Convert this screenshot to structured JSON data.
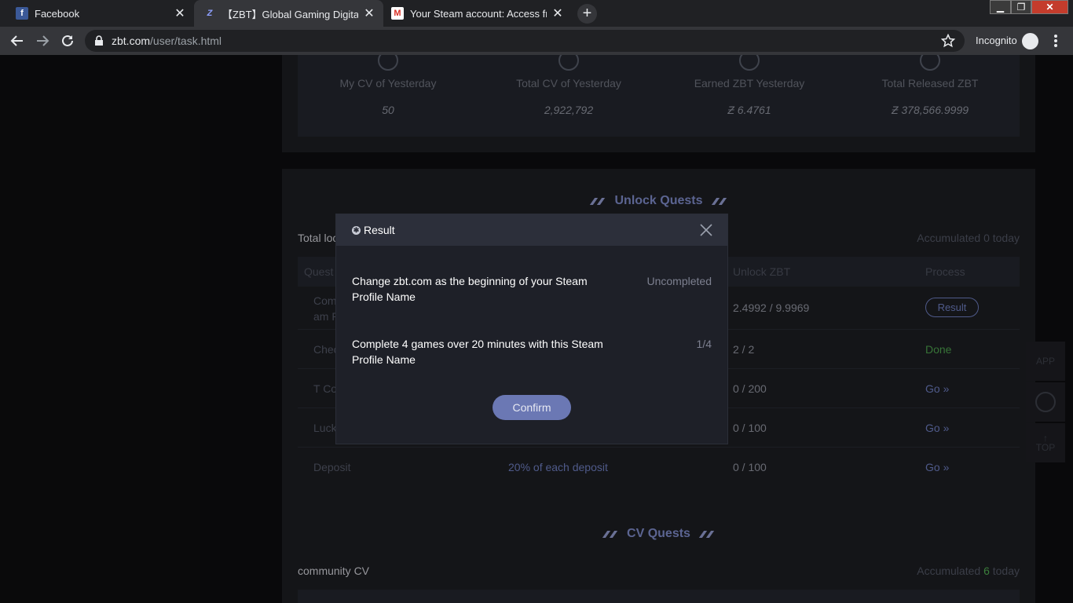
{
  "browser": {
    "tabs": [
      {
        "title": "Facebook",
        "favicon": "facebook-icon"
      },
      {
        "title": "【ZBT】Global Gaming Digital Asse",
        "favicon": "zbt-icon",
        "active": true
      },
      {
        "title": "Your Steam account: Access from",
        "favicon": "gmail-icon"
      }
    ],
    "url_host": "zbt.com",
    "url_path": "/user/task.html",
    "incognito_label": "Incognito"
  },
  "stats": [
    {
      "label": "My CV of Yesterday",
      "value": "50"
    },
    {
      "label": "Total CV of Yesterday",
      "value": "2,922,792"
    },
    {
      "label": "Earned ZBT Yesterday",
      "value": "Ƶ 6.4761"
    },
    {
      "label": "Total Released ZBT",
      "value": "Ƶ 378,566.9999"
    }
  ],
  "unlock_quests": {
    "title": "Unlock Quests",
    "left_label": "Total loc",
    "accumulated_prefix": "Accumulated",
    "accumulated_value": "0",
    "accumulated_suffix": "today",
    "headers": {
      "quest": "Quest",
      "unlock": "Unlock ZBT",
      "process": "Process"
    },
    "rows": [
      {
        "quest_line1": "Com",
        "quest_line2": "am P",
        "reward": "",
        "unlock": "2.4992 / 9.9969",
        "process": "Result"
      },
      {
        "quest_line1": "Chec",
        "reward": "",
        "unlock": "2 / 2",
        "process": "Done"
      },
      {
        "quest_line1": "T Co",
        "reward": "",
        "unlock": "0 / 200",
        "process": "Go"
      },
      {
        "quest_line1": "Luck",
        "reward": "",
        "unlock": "0 / 100",
        "process": "Go"
      },
      {
        "quest_line1": "Deposit",
        "reward": "20% of each deposit",
        "unlock": "0 / 100",
        "process": "Go"
      }
    ]
  },
  "cv_quests": {
    "title": "CV Quests",
    "left_label": "community CV",
    "accumulated_prefix": "Accumulated",
    "accumulated_value": "6",
    "accumulated_suffix": "today"
  },
  "side_widgets": {
    "top_label": "TOP",
    "app_label": "APP"
  },
  "modal": {
    "title": "Result",
    "items": [
      {
        "text": "Change zbt.com as the beginning of your Steam Profile Name",
        "status": "Uncompleted"
      },
      {
        "text": "Complete 4 games over 20 minutes with this Steam Profile Name",
        "status": "1/4"
      }
    ],
    "confirm_label": "Confirm"
  },
  "colors": {
    "accent": "#6b78b4",
    "done": "#4a9a4a",
    "background": "#0d0d0f"
  }
}
